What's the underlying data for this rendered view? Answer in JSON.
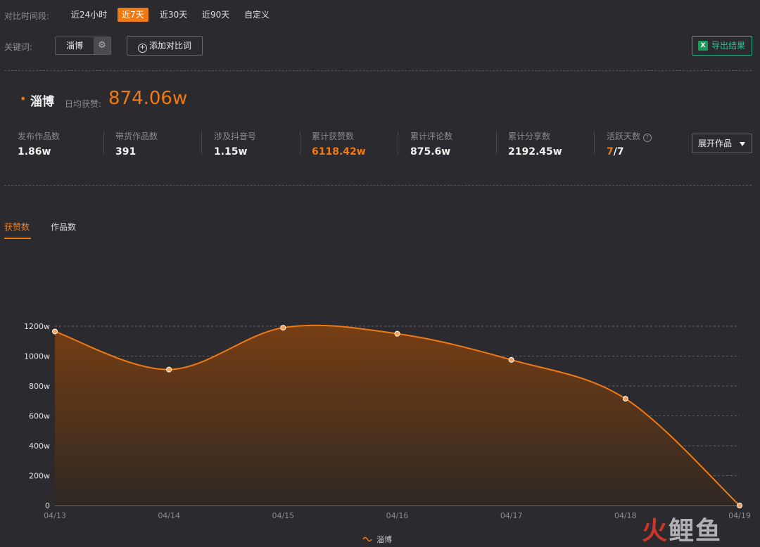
{
  "filters": {
    "period_label": "对比时间段:",
    "periods": [
      "近24小时",
      "近7天",
      "近30天",
      "近90天",
      "自定义"
    ],
    "active_period": "近7天",
    "keyword_label": "关键词:",
    "keyword": "淄博",
    "add_compare_label": "添加对比词",
    "export_label": "导出结果",
    "export_icon_text": "X"
  },
  "summary": {
    "bullet": "•",
    "keyword": "淄博",
    "daily_avg_label": "日均获赞:",
    "daily_avg_value": "874.06w"
  },
  "stats": [
    {
      "label": "发布作品数",
      "value": "1.86w"
    },
    {
      "label": "带货作品数",
      "value": "391"
    },
    {
      "label": "涉及抖音号",
      "value": "1.15w"
    },
    {
      "label": "累计获赞数",
      "value": "6118.42w"
    },
    {
      "label": "累计评论数",
      "value": "875.6w"
    },
    {
      "label": "累计分享数",
      "value": "2192.45w"
    }
  ],
  "active_days": {
    "label": "活跃天数",
    "value_num": "7",
    "value_den": "/7"
  },
  "expand_label": "展开作品",
  "tabs": [
    "获赞数",
    "作品数"
  ],
  "colors": {
    "accent": "#f07a12",
    "export": "#22c596",
    "background": "#2b2b2f"
  },
  "chart_data": {
    "type": "area",
    "x": [
      "04/13",
      "04/14",
      "04/15",
      "04/16",
      "04/17",
      "04/18",
      "04/19"
    ],
    "series": [
      {
        "name": "淄博",
        "values": [
          1165,
          910,
          1190,
          1150,
          975,
          715,
          0
        ]
      }
    ],
    "ylim": [
      0,
      1200
    ],
    "yticks": [
      "0",
      "200w",
      "400w",
      "600w",
      "800w",
      "1000w",
      "1200w"
    ],
    "grid": true,
    "legend": "bottom"
  },
  "watermark": "火鲤鱼"
}
